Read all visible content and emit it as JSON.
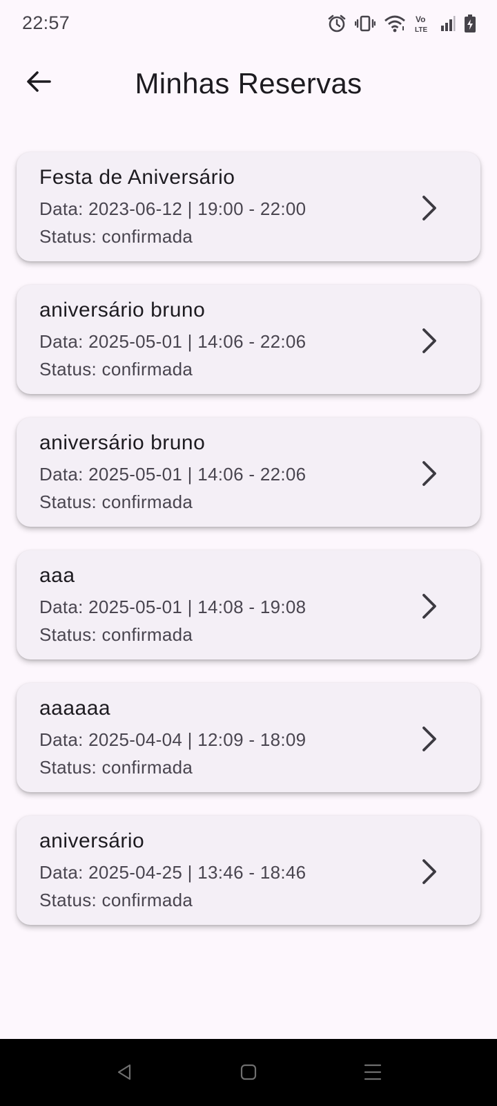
{
  "status_bar": {
    "time": "22:57",
    "icons": [
      "alarm-icon",
      "vibrate-icon",
      "wifi-icon",
      "volte-icon",
      "signal-icon",
      "battery-charging-icon"
    ],
    "volte_text": "Vo LTE"
  },
  "app_bar": {
    "title": "Minhas Reservas",
    "back_icon": "arrow-back-icon"
  },
  "reservations": [
    {
      "title": "Festa de Aniversário",
      "date_line": "Data: 2023-06-12 | 19:00 - 22:00",
      "status_line": "Status: confirmada"
    },
    {
      "title": "aniversário bruno",
      "date_line": "Data: 2025-05-01 | 14:06 - 22:06",
      "status_line": "Status: confirmada"
    },
    {
      "title": "aniversário bruno",
      "date_line": "Data: 2025-05-01 | 14:06 - 22:06",
      "status_line": "Status: confirmada"
    },
    {
      "title": "aaa",
      "date_line": "Data: 2025-05-01 | 14:08 - 19:08",
      "status_line": "Status: confirmada"
    },
    {
      "title": "aaaaaa",
      "date_line": "Data: 2025-04-04 | 12:09 - 18:09",
      "status_line": "Status: confirmada"
    },
    {
      "title": "aniversário",
      "date_line": "Data: 2025-04-25 | 13:46 - 18:46",
      "status_line": "Status: confirmada"
    }
  ],
  "nav_bar": {
    "icons": [
      "nav-back-icon",
      "nav-home-icon",
      "nav-menu-icon"
    ]
  },
  "colors": {
    "background": "#fdf7fd",
    "card": "#f4eff6",
    "text_primary": "#1d1b20",
    "text_secondary": "#49454f",
    "nav_bar": "#000000"
  }
}
